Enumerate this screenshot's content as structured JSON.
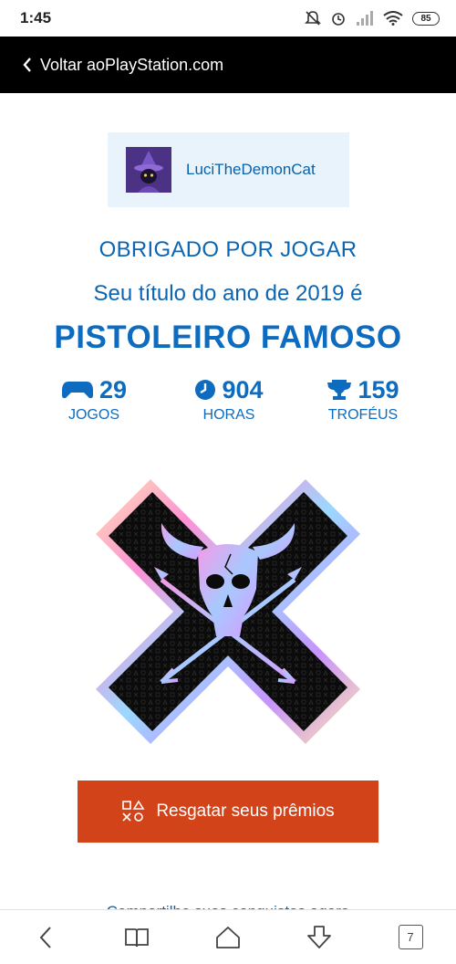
{
  "status_bar": {
    "time": "1:45",
    "battery": "85"
  },
  "header": {
    "back_label": "Voltar aoPlayStation.com"
  },
  "profile": {
    "username": "LuciTheDemonCat"
  },
  "recap": {
    "thanks": "OBRIGADO POR JOGAR",
    "year_line": "Seu título do ano de 2019 é",
    "title": "PISTOLEIRO FAMOSO"
  },
  "stats": [
    {
      "icon": "gamepad-icon",
      "value": "29",
      "label": "JOGOS"
    },
    {
      "icon": "clock-icon",
      "value": "904",
      "label": "HORAS"
    },
    {
      "icon": "trophy-icon",
      "value": "159",
      "label": "TROFÉUS"
    }
  ],
  "redeem": {
    "label": "Resgatar seus prêmios",
    "icon": "playstation-shapes-icon"
  },
  "share": {
    "label": "Compartilhe suas conquistas agora"
  },
  "browser_nav": {
    "tab_count": "7"
  },
  "colors": {
    "accent_blue": "#0d6cc0",
    "cta_orange": "#d3431a",
    "header_black": "#000000"
  }
}
